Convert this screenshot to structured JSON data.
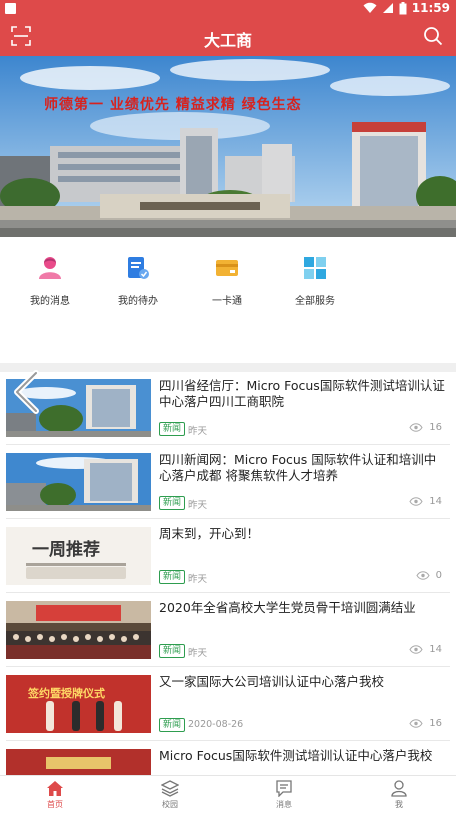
{
  "status_bar": {
    "time": "11:59"
  },
  "header": {
    "title": "大工商",
    "scan_icon": "scan-icon",
    "search_icon": "search-icon"
  },
  "banner": {
    "slogan": "师德第一  业绩优先  精益求精  绿色生态"
  },
  "quick_menu": [
    {
      "label": "我的消息",
      "icon": "user-message-icon",
      "color": "#e94b8a"
    },
    {
      "label": "我的待办",
      "icon": "todo-doc-icon",
      "color": "#2f7de1"
    },
    {
      "label": "一卡通",
      "icon": "card-icon",
      "color": "#f2b233"
    },
    {
      "label": "全部服务",
      "icon": "grid-icon",
      "color": "#2fa8e0"
    }
  ],
  "news": [
    {
      "title": "四川省经信厅：Micro Focus国际软件测试培训认证中心落户四川工商职院",
      "tag": "新闻",
      "date": "昨天",
      "views": "16"
    },
    {
      "title": "四川新闻网：Micro Focus 国际软件认证和培训中心落户成都 将聚焦软件人才培养",
      "tag": "新闻",
      "date": "昨天",
      "views": "14"
    },
    {
      "title": "周末到，开心到！",
      "tag": "新闻",
      "date": "昨天",
      "views": "0",
      "thumb_text": "一周推荐"
    },
    {
      "title": "2020年全省高校大学生党员骨干培训圆满结业",
      "tag": "新闻",
      "date": "昨天",
      "views": "14"
    },
    {
      "title": "又一家国际大公司培训认证中心落户我校",
      "tag": "新闻",
      "date": "2020-08-26",
      "views": "16",
      "thumb_text": "签约暨授牌仪式"
    },
    {
      "title": "Micro Focus国际软件测试培训认证中心落户我校",
      "tag": "",
      "date": "",
      "views": ""
    }
  ],
  "tabbar": [
    {
      "label": "首页",
      "icon": "home-icon",
      "active": true
    },
    {
      "label": "校园",
      "icon": "campus-layers-icon",
      "active": false
    },
    {
      "label": "消息",
      "icon": "message-icon",
      "active": false
    },
    {
      "label": "我",
      "icon": "profile-icon",
      "active": false
    }
  ],
  "colors": {
    "brand": "#de4a4a",
    "tag_green": "#2e9d4f",
    "muted": "#999999"
  }
}
